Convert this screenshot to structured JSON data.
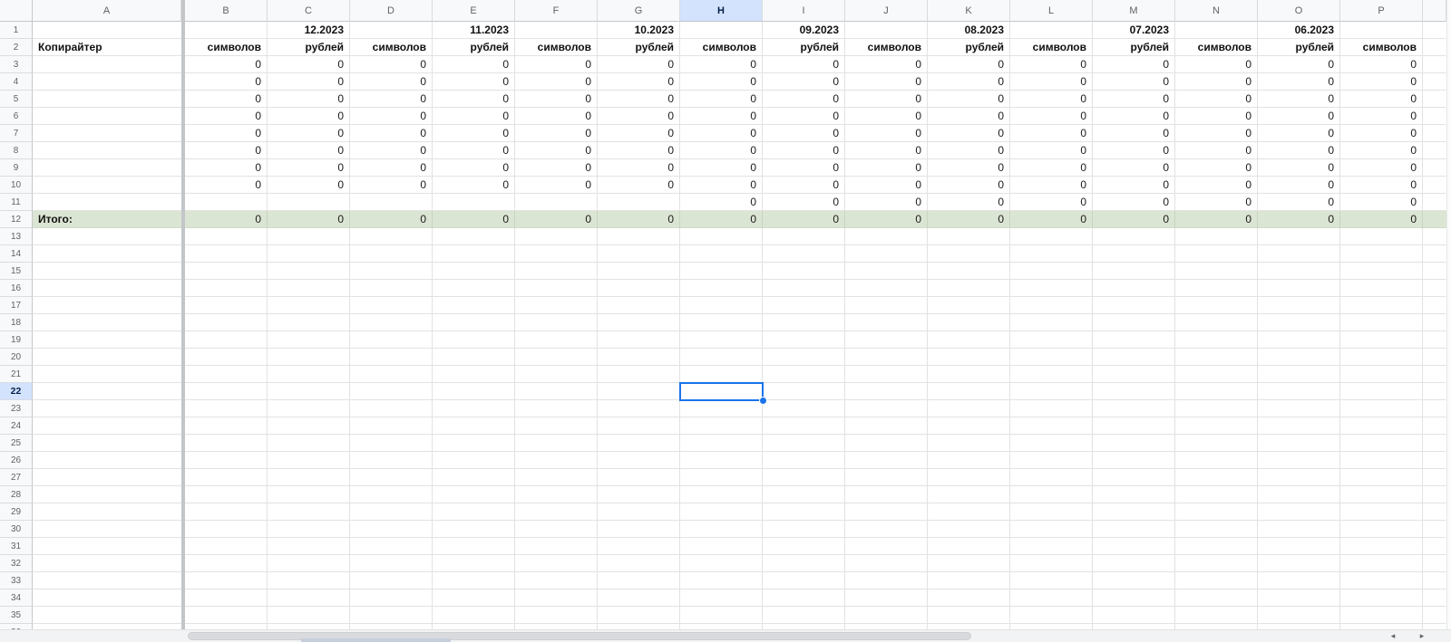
{
  "sheet": {
    "column_headers": [
      "A",
      "B",
      "C",
      "D",
      "E",
      "F",
      "G",
      "H",
      "I",
      "J",
      "K",
      "L",
      "M",
      "N",
      "O",
      "P"
    ],
    "selection": {
      "active_cell": "H22",
      "column": "H",
      "row": 22
    },
    "visible_rows": {
      "first": 1,
      "last_full": 35,
      "last_partial": 36
    },
    "months_row": {
      "n": 1,
      "cells": {
        "C": "12.2023",
        "E": "11.2023",
        "G": "10.2023",
        "I": "09.2023",
        "K": "08.2023",
        "M": "07.2023",
        "O": "06.2023"
      }
    },
    "labels_row": {
      "n": 2,
      "cells": {
        "A": "Копирайтер",
        "B": "символов",
        "C": "рублей",
        "D": "символов",
        "E": "рублей",
        "F": "символов",
        "G": "рублей",
        "H": "символов",
        "I": "рублей",
        "J": "символов",
        "K": "рублей",
        "L": "символов",
        "M": "рублей",
        "N": "символов",
        "O": "рублей",
        "P": "символов"
      }
    },
    "data_rows": [
      {
        "n": 3,
        "cells": {
          "B": "0",
          "C": "0",
          "D": "0",
          "E": "0",
          "F": "0",
          "G": "0",
          "H": "0",
          "I": "0",
          "J": "0",
          "K": "0",
          "L": "0",
          "M": "0",
          "N": "0",
          "O": "0",
          "P": "0"
        }
      },
      {
        "n": 4,
        "cells": {
          "B": "0",
          "C": "0",
          "D": "0",
          "E": "0",
          "F": "0",
          "G": "0",
          "H": "0",
          "I": "0",
          "J": "0",
          "K": "0",
          "L": "0",
          "M": "0",
          "N": "0",
          "O": "0",
          "P": "0"
        }
      },
      {
        "n": 5,
        "cells": {
          "B": "0",
          "C": "0",
          "D": "0",
          "E": "0",
          "F": "0",
          "G": "0",
          "H": "0",
          "I": "0",
          "J": "0",
          "K": "0",
          "L": "0",
          "M": "0",
          "N": "0",
          "O": "0",
          "P": "0"
        }
      },
      {
        "n": 6,
        "cells": {
          "B": "0",
          "C": "0",
          "D": "0",
          "E": "0",
          "F": "0",
          "G": "0",
          "H": "0",
          "I": "0",
          "J": "0",
          "K": "0",
          "L": "0",
          "M": "0",
          "N": "0",
          "O": "0",
          "P": "0"
        }
      },
      {
        "n": 7,
        "cells": {
          "B": "0",
          "C": "0",
          "D": "0",
          "E": "0",
          "F": "0",
          "G": "0",
          "H": "0",
          "I": "0",
          "J": "0",
          "K": "0",
          "L": "0",
          "M": "0",
          "N": "0",
          "O": "0",
          "P": "0"
        }
      },
      {
        "n": 8,
        "cells": {
          "B": "0",
          "C": "0",
          "D": "0",
          "E": "0",
          "F": "0",
          "G": "0",
          "H": "0",
          "I": "0",
          "J": "0",
          "K": "0",
          "L": "0",
          "M": "0",
          "N": "0",
          "O": "0",
          "P": "0"
        }
      },
      {
        "n": 9,
        "cells": {
          "B": "0",
          "C": "0",
          "D": "0",
          "E": "0",
          "F": "0",
          "G": "0",
          "H": "0",
          "I": "0",
          "J": "0",
          "K": "0",
          "L": "0",
          "M": "0",
          "N": "0",
          "O": "0",
          "P": "0"
        }
      },
      {
        "n": 10,
        "cells": {
          "B": "0",
          "C": "0",
          "D": "0",
          "E": "0",
          "F": "0",
          "G": "0",
          "H": "0",
          "I": "0",
          "J": "0",
          "K": "0",
          "L": "0",
          "M": "0",
          "N": "0",
          "O": "0",
          "P": "0"
        }
      },
      {
        "n": 11,
        "cells": {
          "H": "0",
          "I": "0",
          "J": "0",
          "K": "0",
          "L": "0",
          "M": "0",
          "N": "0",
          "O": "0",
          "P": "0"
        }
      }
    ],
    "total_row": {
      "n": 12,
      "cells": {
        "A": "Итого:",
        "B": "0",
        "C": "0",
        "D": "0",
        "E": "0",
        "F": "0",
        "G": "0",
        "H": "0",
        "I": "0",
        "J": "0",
        "K": "0",
        "L": "0",
        "M": "0",
        "N": "0",
        "O": "0",
        "P": "0"
      }
    },
    "scrollbar": {
      "left_arrow_icon": "◂",
      "right_arrow_icon": "▸"
    },
    "colors": {
      "selection_border": "#1a73e8",
      "header_highlight_bg": "#d3e3fd",
      "header_highlight_text": "#041e49",
      "total_row_bg": "#dbe5d3",
      "gridline": "#e2e2e2",
      "header_text": "#5f6368",
      "freeze_bar": "#c3c6c9"
    }
  }
}
